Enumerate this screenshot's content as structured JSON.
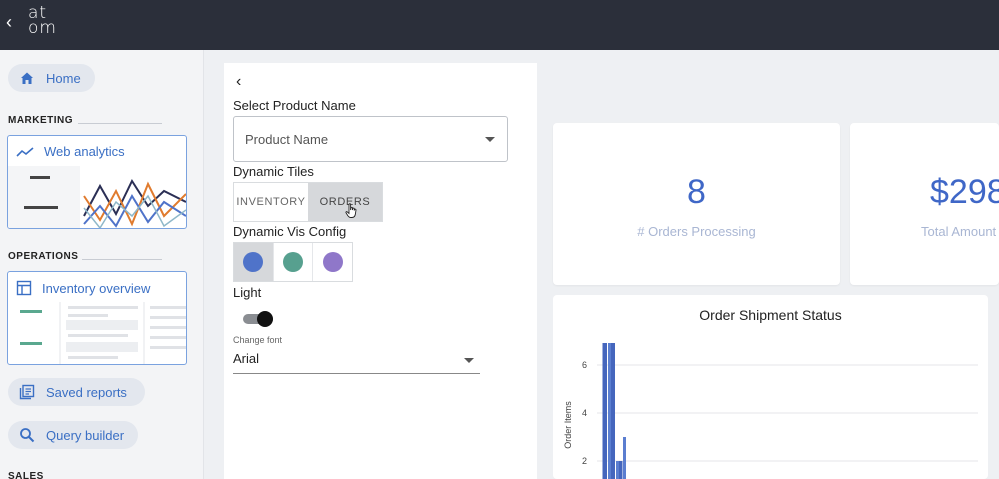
{
  "topbar": {
    "back_glyph": "‹",
    "logo_line1": "at",
    "logo_line2": "om"
  },
  "sidebar": {
    "home_label": "Home",
    "marketing_label": "MARKETING",
    "web_analytics_label": "Web analytics",
    "operations_label": "OPERATIONS",
    "inventory_label": "Inventory overview",
    "saved_reports_label": "Saved reports",
    "query_builder_label": "Query builder",
    "sales_label": "SALES"
  },
  "config": {
    "back_glyph": "‹",
    "select_product_label": "Select Product Name",
    "product_placeholder": "Product Name",
    "dynamic_tiles_label": "Dynamic Tiles",
    "tile_options": [
      "INVENTORY",
      "ORDERS"
    ],
    "selected_tile": "ORDERS",
    "dynamic_vis_label": "Dynamic Vis Config",
    "vis_colors": [
      "#4f73c9",
      "#57a08f",
      "#8f77c9"
    ],
    "selected_vis_color": "#4f73c9",
    "light_label": "Light",
    "light_on": true,
    "change_font_label": "Change font",
    "font_value": "Arial"
  },
  "tiles": [
    {
      "value": "8",
      "label": "# Orders Processing"
    },
    {
      "value": "$298",
      "label": "Total Amount"
    }
  ],
  "colors": {
    "accent": "#3f67c7",
    "topbar": "#2b2f3a",
    "nav_text": "#3a6fc4"
  },
  "chart_data": {
    "type": "bar",
    "title": "Order Shipment Status",
    "ylabel": "Order Items",
    "y_ticks": [
      2,
      4,
      6
    ],
    "ylim": [
      0,
      7
    ],
    "values": [
      7,
      7,
      7,
      2,
      2,
      3
    ]
  }
}
